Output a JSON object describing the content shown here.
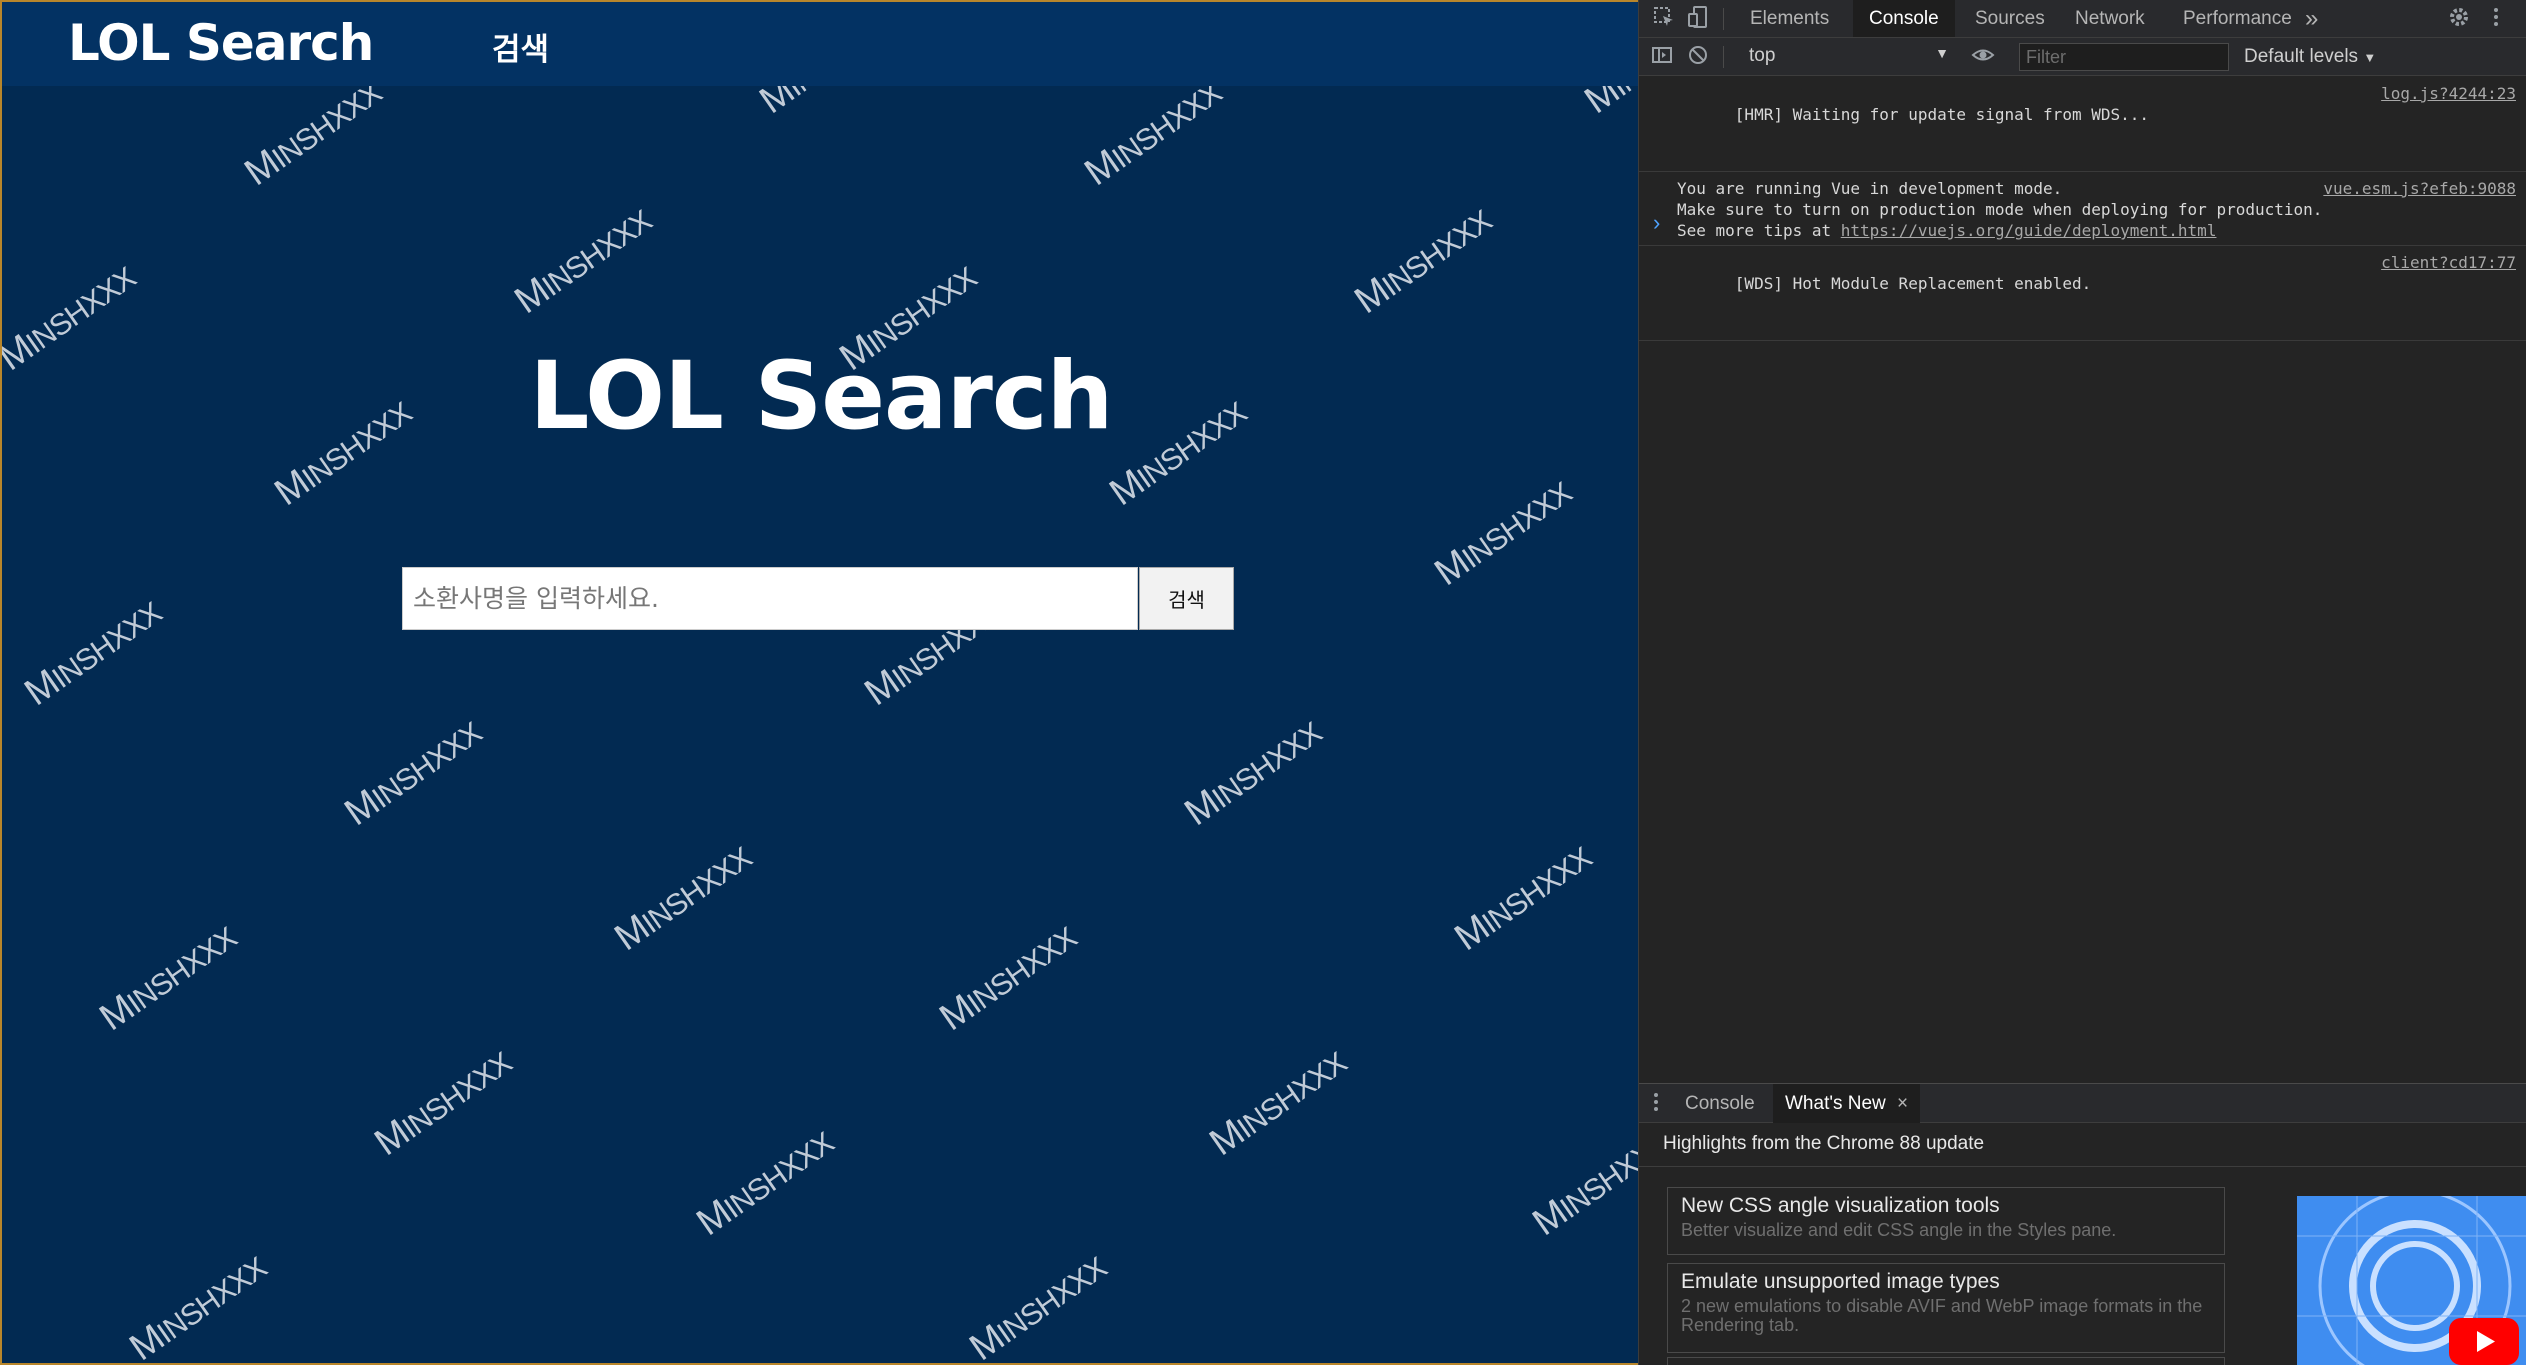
{
  "page": {
    "brand": "LOL Search",
    "nav_search": "검색",
    "hero_title": "LOL Search",
    "search_placeholder": "소환사명을 입력하세요.",
    "search_button": "검색",
    "watermark_text": "MINSHXXX"
  },
  "devtools": {
    "tabs": [
      "Elements",
      "Console",
      "Sources",
      "Network",
      "Performance"
    ],
    "active_tab": "Console",
    "more_tabs": "»",
    "context": "top",
    "filter_placeholder": "Filter",
    "levels": "Default levels",
    "logs": [
      {
        "text": "[HMR] Waiting for update signal from WDS...",
        "source": "log.js?4244:23"
      },
      {
        "text": "You are running Vue in development mode.\nMake sure to turn on production mode when deploying for production.\nSee more tips at ",
        "link": "https://vuejs.org/guide/deployment.html",
        "source": "vue.esm.js?efeb:9088"
      },
      {
        "text": "[WDS] Hot Module Replacement enabled.",
        "source": "client?cd17:77"
      }
    ],
    "prompt": "›",
    "drawer": {
      "tabs": [
        "Console",
        "What's New"
      ],
      "active_tab": "What's New",
      "close": "×",
      "headline": "Highlights from the Chrome 88 update",
      "features": [
        {
          "title": "New CSS angle visualization tools",
          "desc": "Better visualize and edit CSS angle in the Styles pane."
        },
        {
          "title": "Emulate unsupported image types",
          "desc": "2 new emulations to disable AVIF and WebP image formats in the Rendering tab."
        }
      ]
    }
  },
  "colors": {
    "page_bg": "#022a52",
    "navbar_bg": "#033263",
    "devtools_bg": "#242424",
    "accent_blue": "#4fa3ff",
    "youtube_red": "#ff0000"
  }
}
